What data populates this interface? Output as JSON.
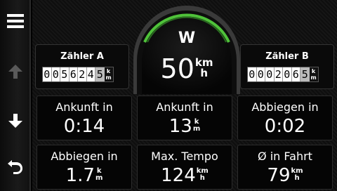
{
  "sidebar": {
    "menu_icon": "hamburger-menu-icon",
    "up_icon": "arrow-up-icon",
    "down_icon": "arrow-down-icon",
    "back_icon": "back-arrow-icon"
  },
  "compass": {
    "heading": "W",
    "speed": "50",
    "unit_top": "km",
    "unit_bottom": "h"
  },
  "trip_a": {
    "label": "Zähler A",
    "digits": [
      "0",
      "0",
      "5",
      "6",
      "2",
      "4",
      "5"
    ],
    "unit_top": "k",
    "unit_bottom": "m"
  },
  "trip_b": {
    "label": "Zähler B",
    "digits": [
      "0",
      "0",
      "0",
      "2",
      "0",
      "6",
      "5"
    ],
    "unit_top": "k",
    "unit_bottom": "m"
  },
  "tiles": [
    {
      "label": "Ankunft in",
      "value": "0:14",
      "unit_top": "",
      "unit_bottom": ""
    },
    {
      "label": "Ankunft in",
      "value": "13",
      "unit_top": "k",
      "unit_bottom": "m"
    },
    {
      "label": "Abbiegen in",
      "value": "0:02",
      "unit_top": "",
      "unit_bottom": ""
    },
    {
      "label": "Abbiegen in",
      "value": "1.7",
      "unit_top": "k",
      "unit_bottom": "m"
    },
    {
      "label": "Max. Tempo",
      "value": "124",
      "unit_top": "km",
      "unit_bottom": "h"
    },
    {
      "label": "Ø in Fahrt",
      "value": "79",
      "unit_top": "km",
      "unit_bottom": "h"
    }
  ],
  "colors": {
    "accent_green": "#4fc23a",
    "background": "#000000",
    "disabled_arrow": "#5a5a5a"
  }
}
